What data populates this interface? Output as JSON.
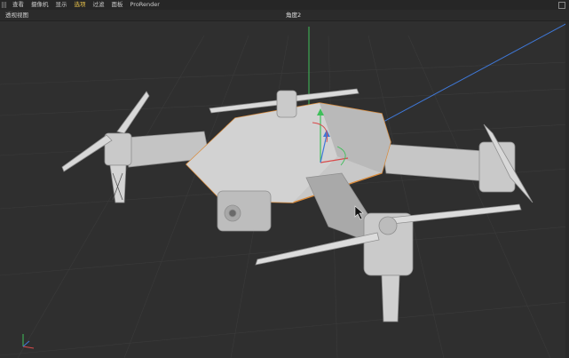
{
  "menubar": {
    "items": [
      {
        "label": "查看",
        "active": false
      },
      {
        "label": "摄像机",
        "active": false
      },
      {
        "label": "显示",
        "active": false
      },
      {
        "label": "选项",
        "active": true
      },
      {
        "label": "过滤",
        "active": false
      },
      {
        "label": "面板",
        "active": false
      },
      {
        "label": "ProRender",
        "active": false
      }
    ]
  },
  "viewport": {
    "title": "透视视图",
    "camera": "角度2",
    "object": "drone-model",
    "gizmo_axes": [
      "x",
      "y",
      "z"
    ]
  },
  "colors": {
    "background": "#2f2f2f",
    "menubar": "#262626",
    "accent": "#e8c24a",
    "selection_outline": "#d98a3a",
    "axis_x": "#d84a4a",
    "axis_y": "#3fbf5a",
    "axis_z": "#3f78d8"
  }
}
